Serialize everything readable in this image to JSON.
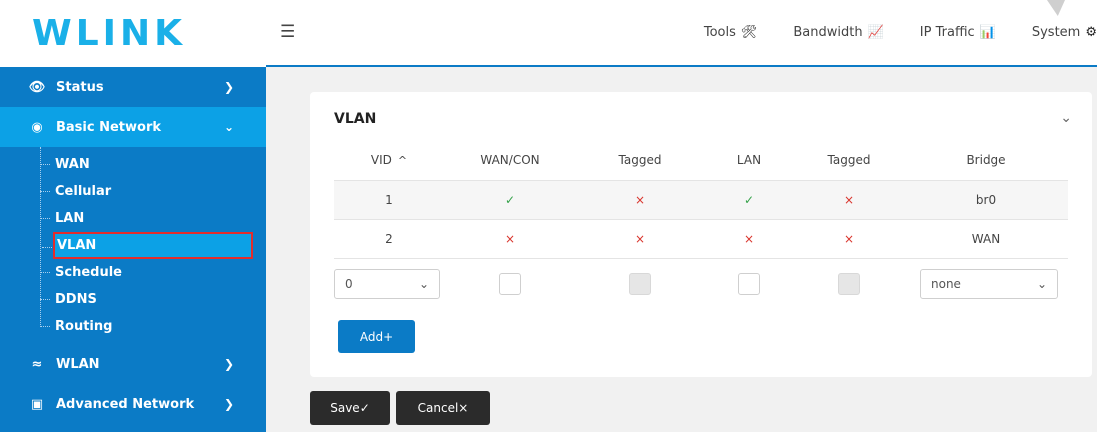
{
  "brand": {
    "logo": "WLINK",
    "color": "#1ab0e8"
  },
  "topnav": {
    "items": [
      {
        "label": "Tools",
        "icon": "tools-icon",
        "glyph": "🛠"
      },
      {
        "label": "Bandwidth",
        "icon": "chart-icon",
        "glyph": "📈"
      },
      {
        "label": "IP Traffic",
        "icon": "area-chart-icon",
        "glyph": "📊"
      },
      {
        "label": "System",
        "icon": "gear-icon",
        "glyph": "⚙"
      }
    ]
  },
  "sidebar": {
    "items": [
      {
        "label": "Status",
        "icon": "eye-icon"
      },
      {
        "label": "Basic Network",
        "icon": "globe-icon"
      },
      {
        "label": "WLAN",
        "icon": "wifi-icon"
      },
      {
        "label": "Advanced Network",
        "icon": "network-icon"
      }
    ],
    "basic_network_sub": [
      "WAN",
      "Cellular",
      "LAN",
      "VLAN",
      "Schedule",
      "DDNS",
      "Routing"
    ]
  },
  "card": {
    "title": "VLAN",
    "columns": [
      "VID",
      "WAN/CON",
      "Tagged",
      "LAN",
      "Tagged",
      "Bridge"
    ],
    "rows": [
      {
        "vid": "1",
        "wan_con": "✓",
        "wan_tagged": "×",
        "lan": "✓",
        "lan_tagged": "×",
        "bridge": "br0"
      },
      {
        "vid": "2",
        "wan_con": "×",
        "wan_tagged": "×",
        "lan": "×",
        "lan_tagged": "×",
        "bridge": "WAN"
      }
    ],
    "new_row": {
      "vid_value": "0",
      "bridge_value": "none"
    },
    "add_label": "Add+"
  },
  "buttons": {
    "save": "Save✓",
    "cancel": "Cancel×"
  },
  "colors": {
    "sidebar": "#0b7bc6",
    "active": "#0ca1e6",
    "check": "#35a24a",
    "cross": "#d9342c",
    "highlight_border": "#e32c2c"
  }
}
